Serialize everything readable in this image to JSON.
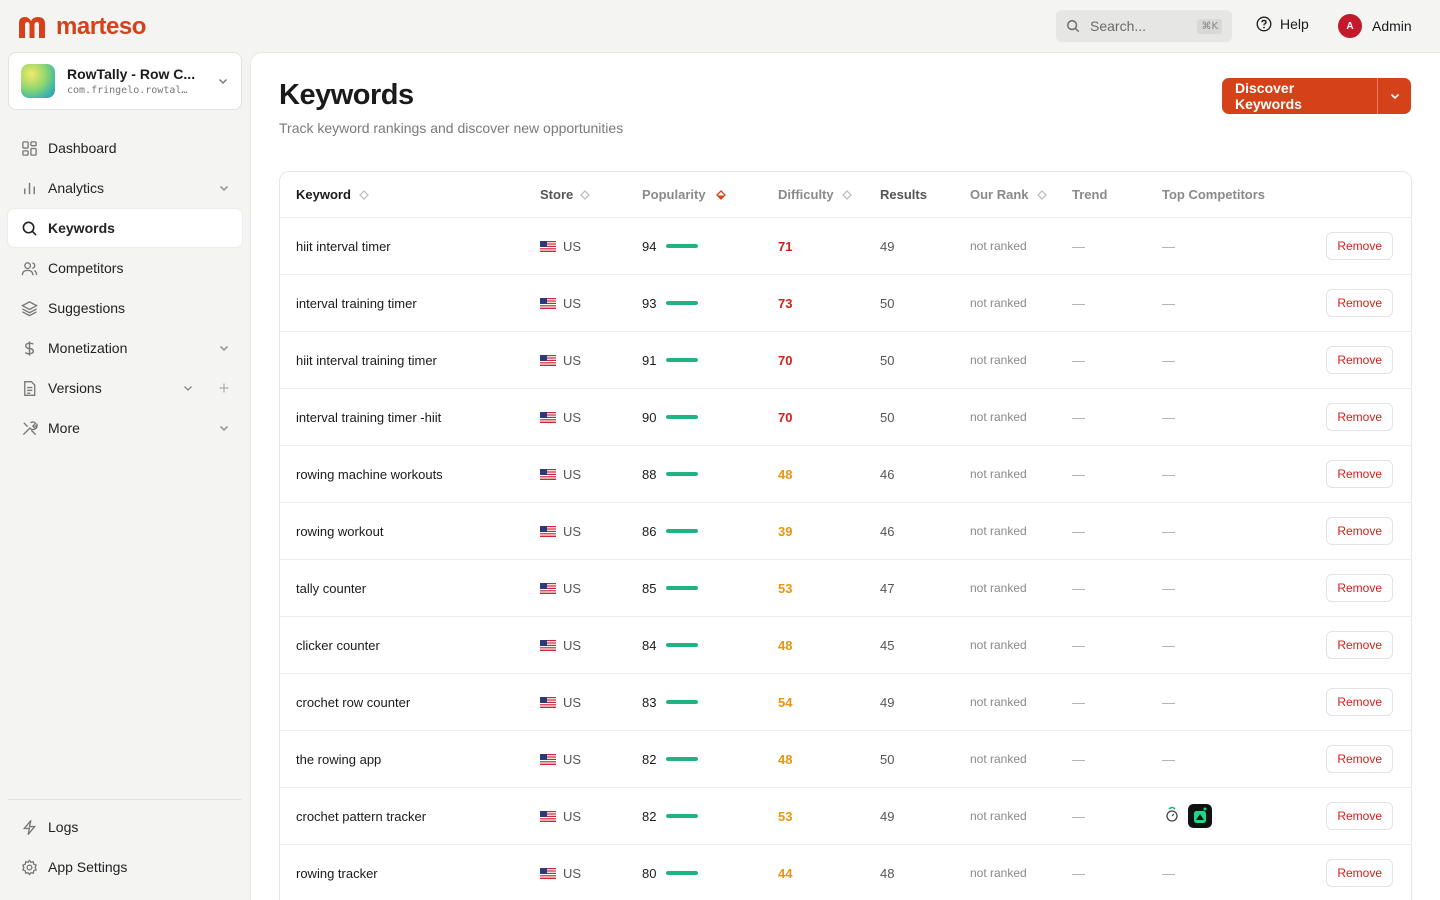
{
  "brand": {
    "name": "marteso",
    "color": "#d4421a"
  },
  "topbar": {
    "search_placeholder": "Search...",
    "search_shortcut": "⌘K",
    "help_label": "Help",
    "user_initial": "A",
    "user_name": "Admin"
  },
  "app": {
    "name": "RowTally - Row C...",
    "bundle": "com.fringelo.rowtal…"
  },
  "sidebar": {
    "items": [
      {
        "label": "Dashboard",
        "icon": "grid-icon"
      },
      {
        "label": "Analytics",
        "icon": "bar-chart-icon"
      },
      {
        "label": "Keywords",
        "icon": "search-icon"
      },
      {
        "label": "Competitors",
        "icon": "users-icon"
      },
      {
        "label": "Suggestions",
        "icon": "layers-icon"
      },
      {
        "label": "Monetization",
        "icon": "dollar-icon"
      },
      {
        "label": "Versions",
        "icon": "file-icon"
      },
      {
        "label": "More",
        "icon": "tools-icon"
      }
    ],
    "bottom": [
      {
        "label": "Logs",
        "icon": "bolt-icon"
      },
      {
        "label": "App Settings",
        "icon": "settings-icon"
      }
    ]
  },
  "page": {
    "title": "Keywords",
    "subtitle": "Track keyword rankings and discover new opportunities",
    "discover_label": "Discover Keywords"
  },
  "table": {
    "headers": {
      "keyword": "Keyword",
      "store": "Store",
      "popularity": "Popularity",
      "difficulty": "Difficulty",
      "results": "Results",
      "rank": "Our Rank",
      "trend": "Trend",
      "competitors": "Top Competitors"
    },
    "remove_label": "Remove",
    "rows": [
      {
        "keyword": "hiit interval timer",
        "store": "US",
        "popularity": "94",
        "difficulty": "71",
        "level": "high",
        "results": "49",
        "rank": "not ranked",
        "trend": "—",
        "competitors": "—"
      },
      {
        "keyword": "interval training timer",
        "store": "US",
        "popularity": "93",
        "difficulty": "73",
        "level": "high",
        "results": "50",
        "rank": "not ranked",
        "trend": "—",
        "competitors": "—"
      },
      {
        "keyword": "hiit interval training timer",
        "store": "US",
        "popularity": "91",
        "difficulty": "70",
        "level": "high",
        "results": "50",
        "rank": "not ranked",
        "trend": "—",
        "competitors": "—"
      },
      {
        "keyword": "interval training timer -hiit",
        "store": "US",
        "popularity": "90",
        "difficulty": "70",
        "level": "high",
        "results": "50",
        "rank": "not ranked",
        "trend": "—",
        "competitors": "—"
      },
      {
        "keyword": "rowing machine workouts",
        "store": "US",
        "popularity": "88",
        "difficulty": "48",
        "level": "mid",
        "results": "46",
        "rank": "not ranked",
        "trend": "—",
        "competitors": "—"
      },
      {
        "keyword": "rowing workout",
        "store": "US",
        "popularity": "86",
        "difficulty": "39",
        "level": "mid",
        "results": "46",
        "rank": "not ranked",
        "trend": "—",
        "competitors": "—"
      },
      {
        "keyword": "tally counter",
        "store": "US",
        "popularity": "85",
        "difficulty": "53",
        "level": "mid",
        "results": "47",
        "rank": "not ranked",
        "trend": "—",
        "competitors": "—"
      },
      {
        "keyword": "clicker counter",
        "store": "US",
        "popularity": "84",
        "difficulty": "48",
        "level": "mid",
        "results": "45",
        "rank": "not ranked",
        "trend": "—",
        "competitors": "—"
      },
      {
        "keyword": "crochet row counter",
        "store": "US",
        "popularity": "83",
        "difficulty": "54",
        "level": "mid",
        "results": "49",
        "rank": "not ranked",
        "trend": "—",
        "competitors": "—"
      },
      {
        "keyword": "the rowing app",
        "store": "US",
        "popularity": "82",
        "difficulty": "48",
        "level": "mid",
        "results": "50",
        "rank": "not ranked",
        "trend": "—",
        "competitors": "—"
      },
      {
        "keyword": "crochet pattern tracker",
        "store": "US",
        "popularity": "82",
        "difficulty": "53",
        "level": "mid",
        "results": "49",
        "rank": "not ranked",
        "trend": "—",
        "competitors": "",
        "has_competitor_icons": true
      },
      {
        "keyword": "rowing tracker",
        "store": "US",
        "popularity": "80",
        "difficulty": "44",
        "level": "mid",
        "results": "48",
        "rank": "not ranked",
        "trend": "—",
        "competitors": "—"
      }
    ]
  }
}
